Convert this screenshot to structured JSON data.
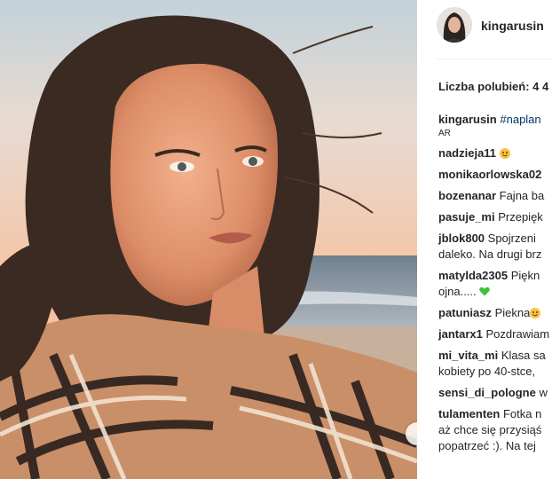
{
  "post": {
    "username": "kingarusin",
    "likes_label": "Liczba polubień: 4 4",
    "caption": {
      "user": "kingarusin",
      "text": "#naplan"
    },
    "caption_extra": "AR"
  },
  "comments": [
    {
      "user": "nadzieja11",
      "text": ""
    },
    {
      "user": "monikaorlowska02",
      "text": ""
    },
    {
      "user": "bozenanar",
      "text": "Fajna ba"
    },
    {
      "user": "pasuje_mi",
      "text": "Przepięk"
    },
    {
      "user": "jblok800",
      "text": "Spojrzeni",
      "line2": "daleko. Na drugi brz"
    },
    {
      "user": "matylda2305",
      "text": "Piękn",
      "line2": "ojna....."
    },
    {
      "user": "patuniasz",
      "text": "Piekna"
    },
    {
      "user": "jantarx1",
      "text": "Pozdrawiam"
    },
    {
      "user": "mi_vita_mi",
      "text": "Klasa sa",
      "line2": "kobiety po 40-stce,"
    },
    {
      "user": "sensi_di_pologne",
      "text": "w"
    },
    {
      "user": "tulamenten",
      "text": "Fotka n",
      "line2": "aż chce się przysiąś",
      "line3": "popatrzeć :). Na tej"
    }
  ],
  "colors": {
    "hashtag": "#003569",
    "heart": "#3cc43c"
  }
}
